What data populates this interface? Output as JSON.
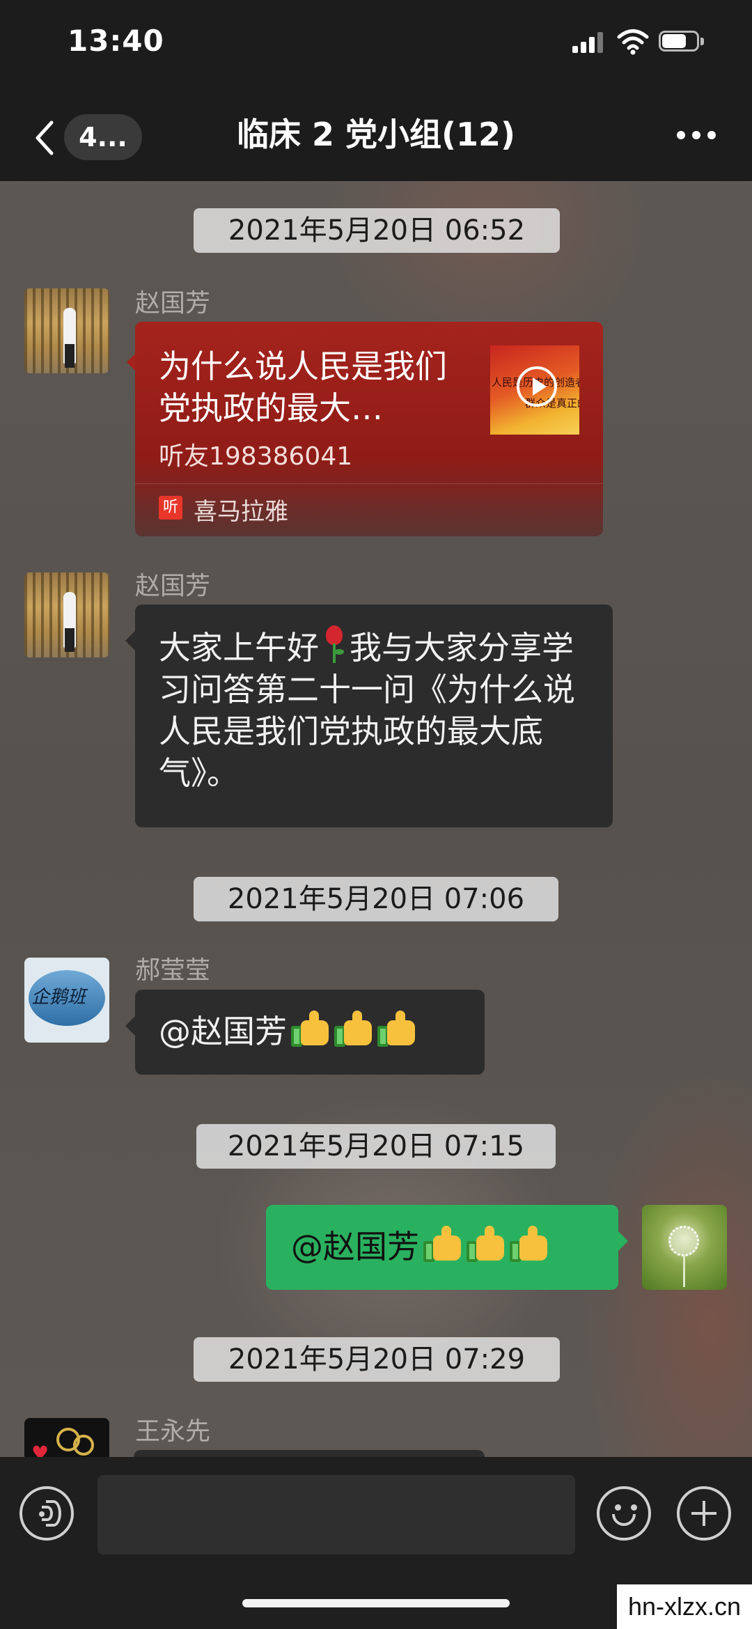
{
  "status_bar": {
    "time": "13:40"
  },
  "nav": {
    "unread_count": "4...",
    "title": "临床 2 党小组(12)"
  },
  "messages": {
    "m1": {
      "timestamp": "2021年5月20日 06:52",
      "sender": "赵国芳",
      "card": {
        "title": "为什么说人民是我们党执政的最大…",
        "subtitle": "听友198386041",
        "thumb_text_1": "人民是历史的创造者",
        "thumb_text_2": "群众是真正的",
        "source_icon": "听",
        "source": "喜马拉雅"
      }
    },
    "m2": {
      "sender": "赵国芳",
      "text_before_emoji": "大家上午好",
      "emoji": "rose-emoji",
      "text_after_emoji": "我与大家分享学习问答第二十一问《为什么说人民是我们党执政的最大底气》。"
    },
    "m3": {
      "timestamp": "2021年5月20日 07:06",
      "sender": "郝莹莹",
      "avatar_text": "企鹅班",
      "text": "@赵国芳",
      "emoji": "thumbs-up-emoji x3"
    },
    "m4": {
      "timestamp": "2021年5月20日 07:15",
      "text": "@赵国芳",
      "emoji": "thumbs-up-emoji x3"
    },
    "m5": {
      "timestamp": "2021年5月20日 07:29",
      "sender": "王永先"
    }
  },
  "icons": {
    "back": "chevron-left-icon",
    "more": "more-dots-icon",
    "voice": "voice-icon",
    "emoji": "emoji-icon",
    "plus": "plus-icon"
  },
  "colors": {
    "accent_green": "#2ab15f",
    "card_red": "#a5231d"
  },
  "watermark": "hn-xlzx.cn"
}
